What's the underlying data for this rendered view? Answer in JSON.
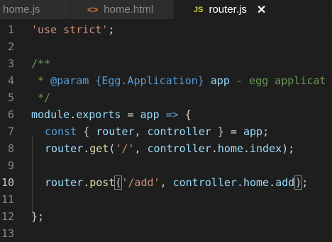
{
  "tabs": [
    {
      "label": "home.js",
      "icon": "js-file-icon"
    },
    {
      "label": "home.html",
      "icon": "html-file-icon",
      "icon_glyph": "<>"
    },
    {
      "label": "router.js",
      "icon": "js-file-icon",
      "icon_glyph": "JS",
      "close": "✕"
    }
  ],
  "line_numbers": [
    "1",
    "2",
    "3",
    "4",
    "5",
    "6",
    "7",
    "8",
    "9",
    "10",
    "11",
    "12",
    "13"
  ],
  "code": {
    "l1": {
      "str": "'use strict'",
      "punct": ";"
    },
    "l3": {
      "cmt": "/**"
    },
    "l4": {
      "cmt1": " * ",
      "tag": "@param",
      "type": "{Egg.Application}",
      "name": " app",
      "desc": " - egg applicat"
    },
    "l5": {
      "cmt": " */"
    },
    "l6": {
      "module": "module",
      "dot": ".",
      "exports": "exports",
      "eq": " = ",
      "app": "app",
      "arrow": " => ",
      "brace": "{"
    },
    "l7": {
      "const": "const",
      "open": " { ",
      "router": "router",
      "comma": ", ",
      "controller": "controller",
      "close": " } = ",
      "app": "app",
      "semi": ";"
    },
    "l8": {
      "router": "router",
      "dot": ".",
      "get": "get",
      "open": "(",
      "path": "'/'",
      "comma": ", ",
      "ctrl": "controller",
      "d1": ".",
      "home": "home",
      "d2": ".",
      "index": "index",
      "close": ");"
    },
    "l10": {
      "router": "router",
      "dot": ".",
      "post": "post",
      "open": "(",
      "path": "'/add'",
      "comma": ", ",
      "ctrl": "controller",
      "d1": ".",
      "home": "home",
      "d2": ".",
      "add": "add",
      "paren": ")",
      "semi": ";"
    },
    "l12": {
      "close": "};"
    }
  },
  "colors": {
    "keyword": "#569cd6",
    "string": "#ce9178",
    "comment": "#6a9955",
    "variable": "#9cdcfe",
    "function": "#dcdcaa",
    "background": "#1e1e1e"
  }
}
